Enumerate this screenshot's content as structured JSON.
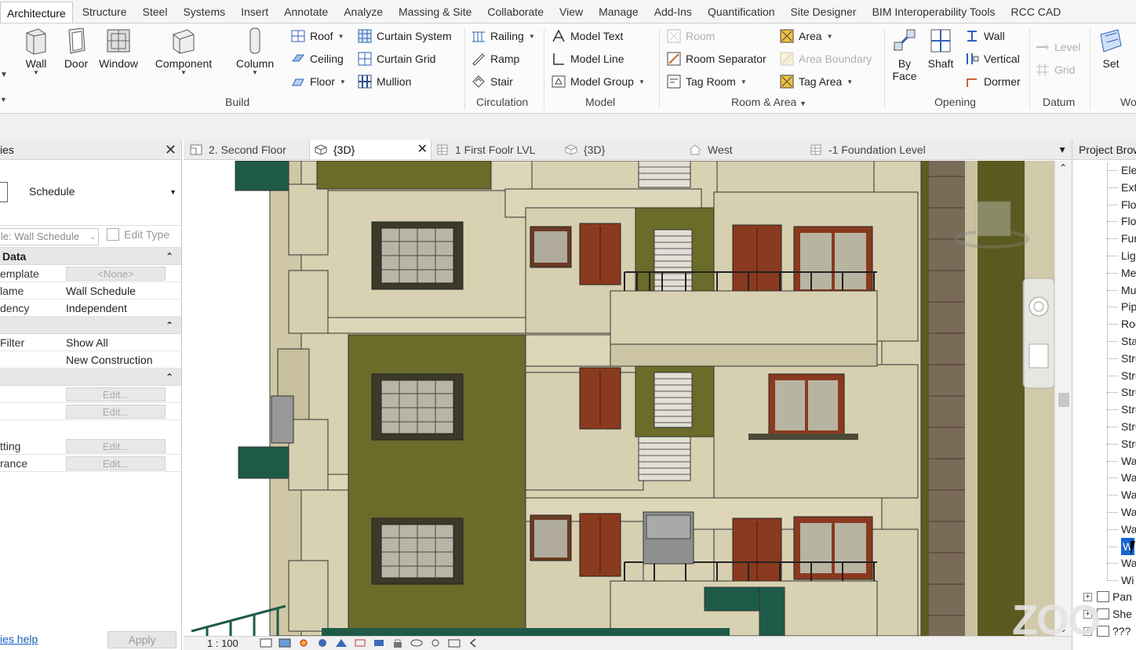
{
  "ribbon_tabs": [
    "Architecture",
    "Structure",
    "Steel",
    "Systems",
    "Insert",
    "Annotate",
    "Analyze",
    "Massing & Site",
    "Collaborate",
    "View",
    "Manage",
    "Add-Ins",
    "Quantification",
    "Site Designer",
    "BIM Interoperability Tools",
    "RCC CAD"
  ],
  "build": {
    "label": "Build",
    "wall": "Wall",
    "door": "Door",
    "window": "Window",
    "component": "Component",
    "column": "Column",
    "roof": "Roof",
    "ceiling": "Ceiling",
    "floor": "Floor",
    "curtain_system": "Curtain System",
    "curtain_grid": "Curtain Grid",
    "mullion": "Mullion"
  },
  "circulation": {
    "label": "Circulation",
    "railing": "Railing",
    "ramp": "Ramp",
    "stair": "Stair"
  },
  "model": {
    "label": "Model",
    "model_text": "Model Text",
    "model_line": "Model Line",
    "model_group": "Model Group"
  },
  "room_area": {
    "label": "Room & Area",
    "room": "Room",
    "room_separator": "Room Separator",
    "tag_room": "Tag Room",
    "area": "Area",
    "area_boundary": "Area Boundary",
    "tag_area": "Tag Area"
  },
  "opening": {
    "label": "Opening",
    "by_face": "By",
    "by_face_2": "Face",
    "shaft": "Shaft",
    "wall": "Wall",
    "vertical": "Vertical",
    "dormer": "Dormer"
  },
  "datum": {
    "label": "Datum",
    "level": "Level",
    "grid": "Grid"
  },
  "work_plane": {
    "set": "Set",
    "label_partial": "Wo"
  },
  "properties": {
    "header": "ies",
    "type_name": "Schedule",
    "type_combo": "le: Wall Schedule",
    "edit_type": "Edit Type",
    "sections": {
      "identity": "Data",
      "phasing": "",
      "other": ""
    },
    "rows": {
      "template_name": "emplate",
      "template_value": "<None>",
      "name_name": "lame",
      "name_value": "Wall Schedule",
      "dependency_name": "dency",
      "dependency_value": "Independent",
      "phase_filter_name": "Filter",
      "phase_filter_value": "Show All",
      "phase_name": "",
      "phase_value": "New Construction",
      "edit1": "Edit...",
      "edit2": "Edit...",
      "formatting_name": "tting",
      "formatting_value": "Edit...",
      "appearance_name": "rance",
      "appearance_value": "Edit..."
    },
    "help_link": "ies help",
    "apply": "Apply"
  },
  "view_tabs": {
    "t1": "2. Second Floor",
    "t2": "{3D}",
    "t3": "1 First Foolr LVL",
    "t4": "{3D}",
    "t5": "West",
    "t6": "-1 Foundation Level"
  },
  "view_scale": "1 : 100",
  "project_browser": {
    "header": "Project Brow",
    "items": [
      "Ele",
      "Ext",
      "Flo",
      "Flo",
      "Fur",
      "Lig",
      "Me",
      "Mu",
      "Pip",
      "Roo",
      "Sta",
      "Stru",
      "Stru",
      "Stru",
      "Stru",
      "Stru",
      "Stru",
      "Wa",
      "Wa",
      "Wa",
      "Wa",
      "Wa",
      "W",
      "Wa",
      "Wi"
    ],
    "groups": [
      "Pan",
      "She",
      "???"
    ]
  },
  "watermark": "ZOO",
  "colors": {
    "accent": "#1763d2",
    "olive": "#6b6b2a",
    "beige": "#d6cfb0",
    "dark_green": "#1e5a48",
    "door_brown": "#8a3a1e"
  }
}
